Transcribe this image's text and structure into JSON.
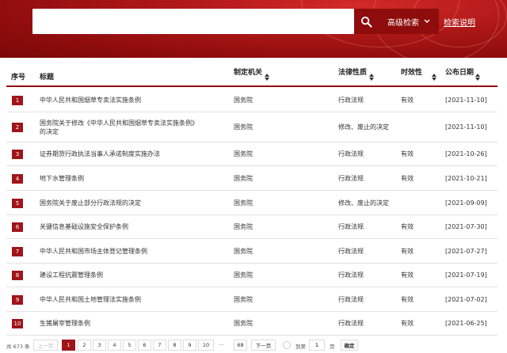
{
  "search": {
    "placeholder": "",
    "advanced_label": "高级检索",
    "help_label": "检索说明"
  },
  "table": {
    "headers": {
      "index": "序号",
      "title": "标题",
      "authority": "制定机关",
      "nature": "法律性质",
      "validity": "时效性",
      "date": "公布日期"
    },
    "rows": [
      {
        "index": "1",
        "title": "中华人民共和国烟草专卖法实施条例",
        "title2": "",
        "authority": "国务院",
        "nature": "行政法规",
        "validity": "有效",
        "date": "[2021-11-10]"
      },
      {
        "index": "2",
        "title": "国务院关于修改《中华人民共和国烟草专卖法实施条例》",
        "title2": "的决定",
        "authority": "国务院",
        "nature": "修改、废止的决定",
        "validity": "",
        "date": "[2021-11-10]"
      },
      {
        "index": "3",
        "title": "证券期货行政执法当事人承诺制度实施办法",
        "title2": "",
        "authority": "国务院",
        "nature": "行政法规",
        "validity": "有效",
        "date": "[2021-10-26]"
      },
      {
        "index": "4",
        "title": "地下水管理条例",
        "title2": "",
        "authority": "国务院",
        "nature": "行政法规",
        "validity": "有效",
        "date": "[2021-10-21]"
      },
      {
        "index": "5",
        "title": "国务院关于废止部分行政法规的决定",
        "title2": "",
        "authority": "国务院",
        "nature": "修改、废止的决定",
        "validity": "",
        "date": "[2021-09-09]"
      },
      {
        "index": "6",
        "title": "关键信息基础设施安全保护条例",
        "title2": "",
        "authority": "国务院",
        "nature": "行政法规",
        "validity": "有效",
        "date": "[2021-07-30]"
      },
      {
        "index": "7",
        "title": "中华人民共和国市场主体登记管理条例",
        "title2": "",
        "authority": "国务院",
        "nature": "行政法规",
        "validity": "有效",
        "date": "[2021-07-27]"
      },
      {
        "index": "8",
        "title": "建设工程抗震管理条例",
        "title2": "",
        "authority": "国务院",
        "nature": "行政法规",
        "validity": "有效",
        "date": "[2021-07-19]"
      },
      {
        "index": "9",
        "title": "中华人民共和国土地管理法实施条例",
        "title2": "",
        "authority": "国务院",
        "nature": "行政法规",
        "validity": "有效",
        "date": "[2021-07-02]"
      },
      {
        "index": "10",
        "title": "生猪屠宰管理条例",
        "title2": "",
        "authority": "国务院",
        "nature": "行政法规",
        "validity": "有效",
        "date": "[2021-06-25]"
      }
    ]
  },
  "pagination": {
    "total_label": "共 673 条",
    "prev_label": "上一页",
    "pages": [
      "1",
      "2",
      "3",
      "4",
      "5",
      "6",
      "7",
      "8",
      "9",
      "10"
    ],
    "ellipsis": "···",
    "last_page": "68",
    "next_label": "下一页",
    "goto_label": "到第",
    "goto_value": "1",
    "page_unit": "页",
    "confirm_label": "确定"
  },
  "colors": {
    "accent": "#a0141a",
    "banner": "#8e0c0c"
  }
}
